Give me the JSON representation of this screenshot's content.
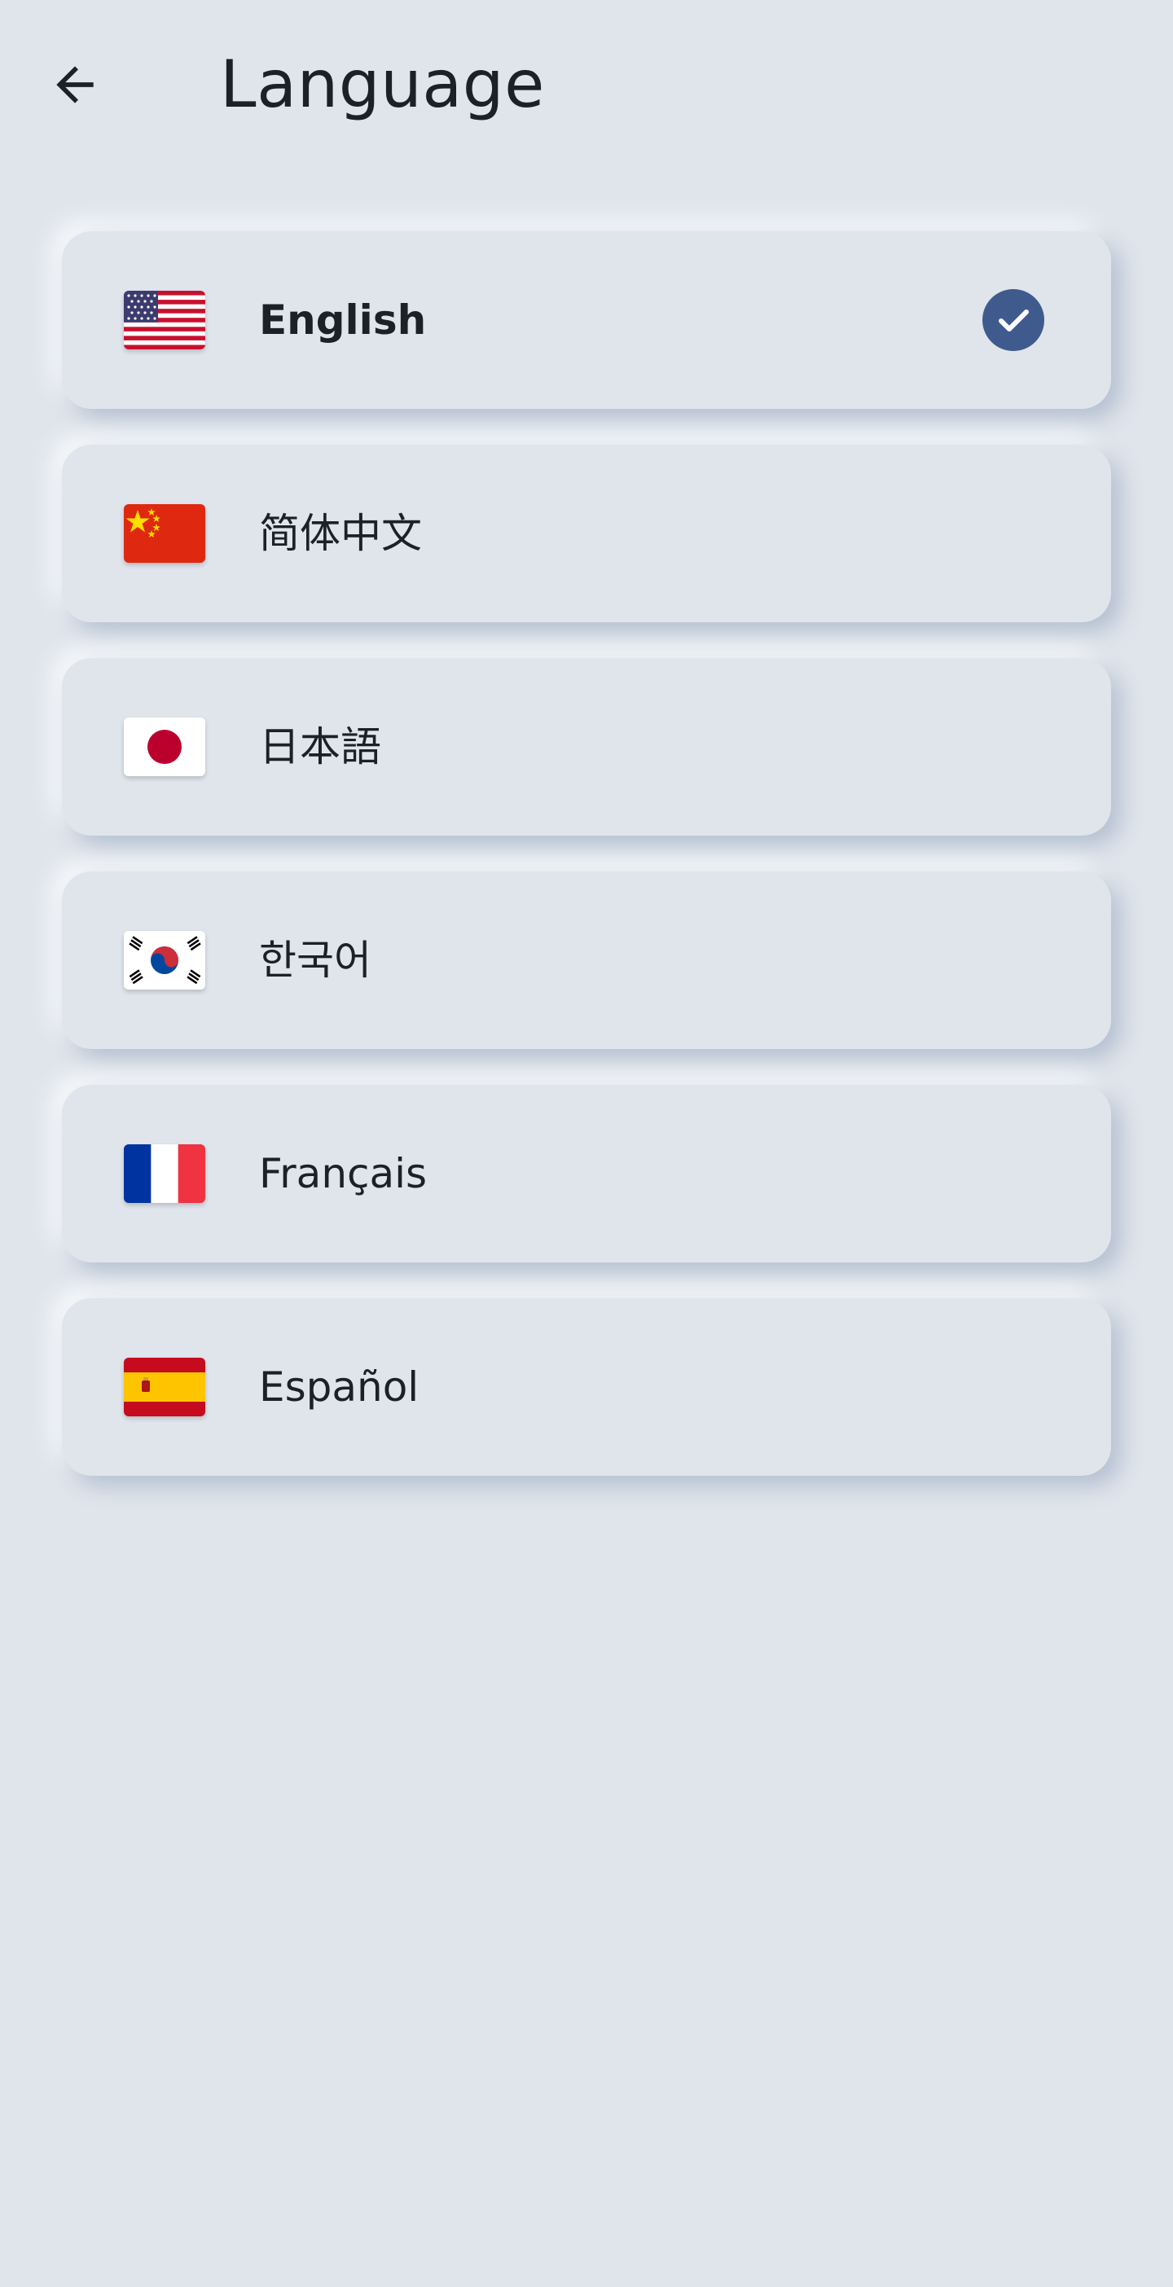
{
  "header": {
    "back_icon": "arrow-left-icon",
    "title": "Language"
  },
  "colors": {
    "background": "#e0e5ec",
    "accent": "#3f5b8e",
    "text": "#1e2027"
  },
  "languages": [
    {
      "label": "English",
      "flag_icon": "us-flag-icon",
      "selected": true
    },
    {
      "label": "简体中文",
      "flag_icon": "china-flag-icon",
      "selected": false
    },
    {
      "label": "日本語",
      "flag_icon": "japan-flag-icon",
      "selected": false
    },
    {
      "label": "한국어",
      "flag_icon": "korea-flag-icon",
      "selected": false
    },
    {
      "label": "Français",
      "flag_icon": "france-flag-icon",
      "selected": false
    },
    {
      "label": "Español",
      "flag_icon": "spain-flag-icon",
      "selected": false
    }
  ],
  "selected_indicator_icon": "check-circle-icon"
}
